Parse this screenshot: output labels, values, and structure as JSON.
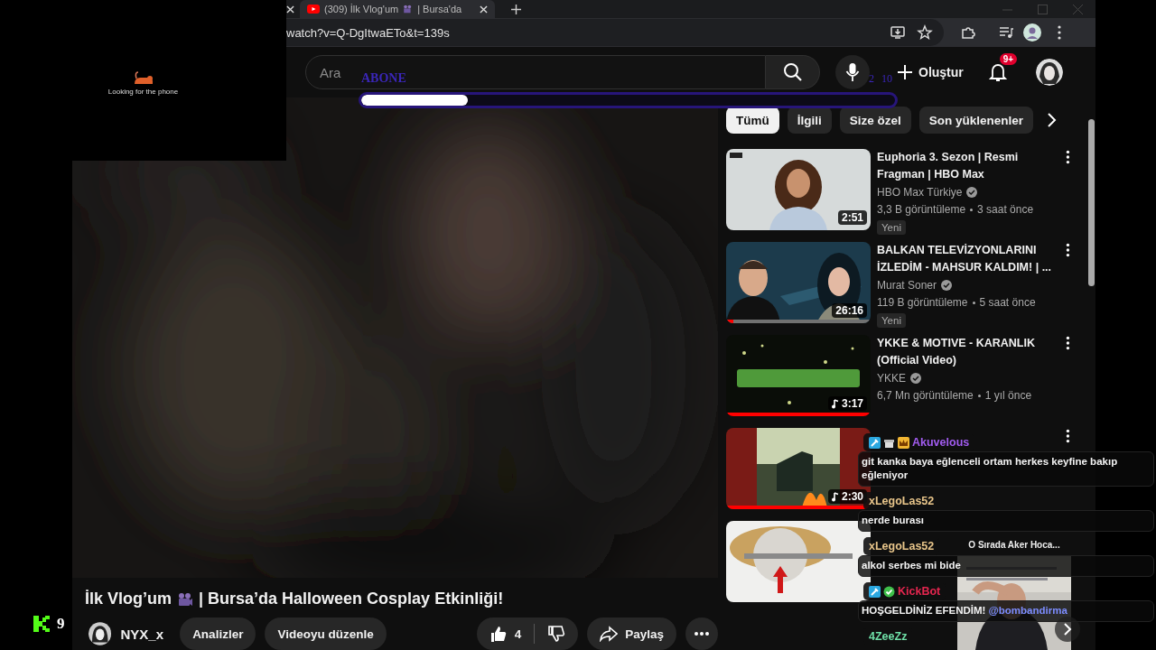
{
  "webcam_overlay": {
    "caption": "Looking for the phone"
  },
  "browser": {
    "tab": {
      "title_parts": [
        "(309) İlk Vlog'um",
        "| Bursa'da"
      ]
    },
    "url": "watch?v=Q-DgItwaETo&t=139s"
  },
  "youtube": {
    "search": {
      "placeholder": "Ara"
    },
    "create_label": "Oluştur",
    "notification_badge": "9+",
    "chips": [
      {
        "label": "Tümü",
        "selected": true
      },
      {
        "label": "İlgili",
        "selected": false
      },
      {
        "label": "Size özel",
        "selected": false
      },
      {
        "label": "Son yüklenenler",
        "selected": false
      }
    ],
    "videos": [
      {
        "title": "Euphoria 3. Sezon | Resmi Fragman | HBO Max",
        "channel": "HBO Max Türkiye",
        "verified": true,
        "views": "3,3 B görüntüleme",
        "age": "3 saat önce",
        "badge": "Yeni",
        "duration": "2:51",
        "music": false,
        "menu": true
      },
      {
        "title": "BALKAN TELEVİZYONLARINI İZLEDİM - MAHSUR KALDIM! | ...",
        "channel": "Murat Soner",
        "verified": true,
        "views": "119 B görüntüleme",
        "age": "5 saat önce",
        "badge": "Yeni",
        "duration": "26:16",
        "music": false,
        "level": 0.05,
        "menu": true
      },
      {
        "title": "YKKE & MOTIVE - KARANLIK (Official Video)",
        "channel": "YKKE",
        "verified": true,
        "views": "6,7 Mn görüntüleme",
        "age": "1 yıl önce",
        "duration": "3:17",
        "music": true,
        "level": 1,
        "menu": true
      },
      {
        "duration": "2:30",
        "music": true,
        "level": 1,
        "menu": true
      },
      {
        "menu": false
      }
    ],
    "video_title_parts": [
      "İlk Vlog’um",
      "| Bursa’da Halloween Cosplay Etkinliği!"
    ],
    "channel": "NYX_x",
    "buttons": [
      "Analizler",
      "Videoyu düzenle"
    ],
    "like_count": "4",
    "share_label": "Paylaş"
  },
  "subscriber_goal": {
    "label": "ABONE",
    "current": "2",
    "target": "10",
    "level": 0.2
  },
  "chat": [
    {
      "username": "Akuvelous",
      "color": "#a25cf0",
      "badges": [
        {
          "kind": "mod"
        },
        {
          "kind": "gift"
        },
        {
          "kind": "crown"
        }
      ],
      "message": "git kanka baya eğlenceli ortam herkes keyfine bakıp eğleniyor"
    },
    {
      "username": "xLegoLas52",
      "color": "#e8c58a",
      "message": "nerde burası"
    },
    {
      "username": "xLegoLas52",
      "color": "#e8c58a",
      "message": "alkol serbes mi bide"
    },
    {
      "username": "KickBot",
      "color": "#e5264f",
      "badges": [
        {
          "kind": "mod"
        },
        {
          "kind": "verified"
        }
      ],
      "message": "HOŞGELDİNİZ EFENDİM!",
      "mention": "@bombandirma"
    },
    {
      "username": "4ZeeZz",
      "color": "#6fe0a8"
    }
  ],
  "mini_player": {
    "title": "O Sırada Aker Hoca..."
  },
  "viewer_count": "9"
}
